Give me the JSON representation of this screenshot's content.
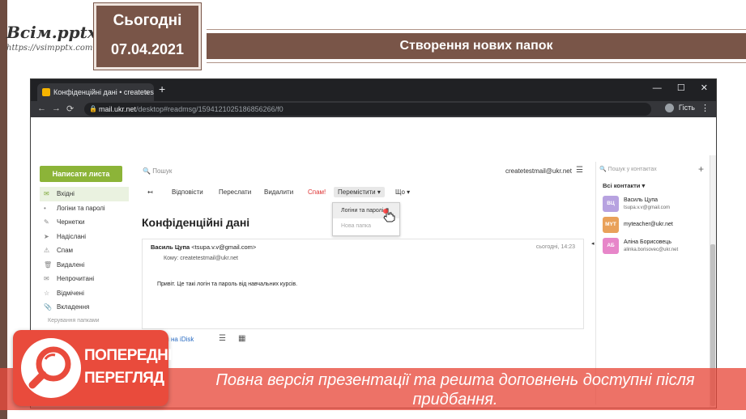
{
  "slide": {
    "logo_main": "Всім.pptx",
    "logo_url": "https://vsimpptx.com",
    "today_label": "Сьогодні",
    "date": "07.04.2021",
    "title": "Створення нових папок"
  },
  "browser": {
    "tab_title": "Конфіденційні дані • createtestmail",
    "tab_close": "×",
    "new_tab": "+",
    "controls": {
      "minimize": "—",
      "maximize": "☐",
      "close": "✕"
    },
    "nav": {
      "back": "←",
      "forward": "→",
      "reload": "⟳"
    },
    "address_host": "mail.ukr.net",
    "address_path": "/desktop#readmsg/1594121025186856266/f0",
    "guest_label": "Гість",
    "menu": "⋮"
  },
  "mail": {
    "compose_label": "Написати листа",
    "sidebar": [
      {
        "icon": "✉",
        "label": "Вхідні"
      },
      {
        "icon": "•",
        "label": "Логіни та паролі"
      },
      {
        "icon": "✎",
        "label": "Чернетки"
      },
      {
        "icon": "➤",
        "label": "Надіслані"
      },
      {
        "icon": "⚠",
        "label": "Спам"
      },
      {
        "icon": "🗑",
        "label": "Видалені"
      },
      {
        "icon": "✉",
        "label": "Непрочитані"
      },
      {
        "icon": "☆",
        "label": "Відмічені"
      },
      {
        "icon": "📎",
        "label": "Вкладення"
      }
    ],
    "sidebar_sub": "Керування папками",
    "search_placeholder": "Пошук",
    "account": "createtestmail@ukr.net",
    "actions": {
      "back": "↤",
      "reply": "Відповісти",
      "forward": "Переслати",
      "delete": "Видалити",
      "spam": "Спам!",
      "move": "Перемістити ▾",
      "more": "Що ▾"
    },
    "dropdown": {
      "item1": "Логіни та паролі",
      "item2": "Нова папка"
    },
    "subject": "Конфіденційні дані",
    "message": {
      "sender_name": "Василь Цупа",
      "sender_email": "<tsupa.v.v@gmail.com>",
      "time": "сьогодні, 14:23",
      "to_label": "Кому:",
      "to": "createtestmail@ukr.net",
      "body": "Привіт. Це такі логін та пароль від навчальних курсів."
    },
    "attach_label": "Зберегти на iDisk"
  },
  "contacts": {
    "search_placeholder": "Пошук у контактах",
    "add": "+",
    "all_label": "Всі контакти ▾",
    "items": [
      {
        "initials": "ВЦ",
        "name": "Василь Цупа",
        "email": "tsupa.v.v@gmail.com",
        "color": "#b7a2e0"
      },
      {
        "initials": "MYT",
        "name": "myteacher@ukr.net",
        "email": "",
        "color": "#e9a15a"
      },
      {
        "initials": "АБ",
        "name": "Аліна Борисовець",
        "email": "alinka.borisovec@ukr.net",
        "color": "#e786c9"
      }
    ]
  },
  "overlay": {
    "badge_line1": "ПОПЕРЕДНІЙ",
    "badge_line2": "ПЕРЕГЛЯД",
    "text": "Повна версія презентації та решта доповнень доступні після придбання."
  }
}
